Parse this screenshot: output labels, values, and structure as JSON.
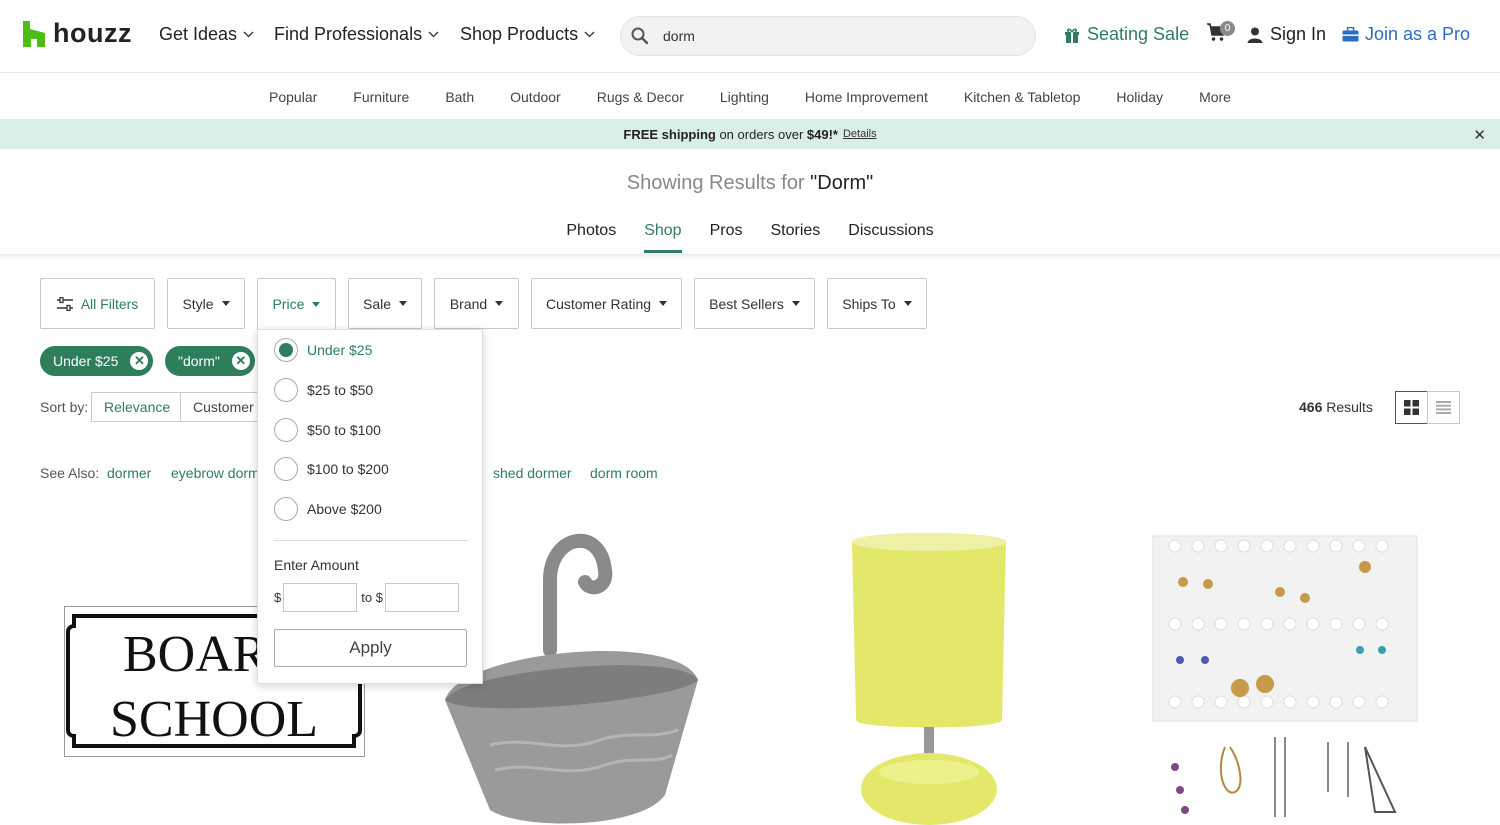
{
  "header": {
    "logo_text": "houzz",
    "nav": [
      {
        "label": "Get Ideas"
      },
      {
        "label": "Find Professionals"
      },
      {
        "label": "Shop Products"
      }
    ],
    "search_value": "dorm",
    "seating_sale": "Seating Sale",
    "cart_count": "0",
    "sign_in": "Sign In",
    "join_pro": "Join as a Pro"
  },
  "subnav": [
    "Popular",
    "Furniture",
    "Bath",
    "Outdoor",
    "Rugs & Decor",
    "Lighting",
    "Home Improvement",
    "Kitchen & Tabletop",
    "Holiday",
    "More"
  ],
  "banner": {
    "free_shipping": "FREE shipping",
    "middle": " on orders over ",
    "amount": "$49!*",
    "details": "Details"
  },
  "results": {
    "prefix": "Showing Results for ",
    "query": "\"Dorm\""
  },
  "tabs": [
    "Photos",
    "Shop",
    "Pros",
    "Stories",
    "Discussions"
  ],
  "filters": {
    "all_filters": "All Filters",
    "style": "Style",
    "price": "Price",
    "sale": "Sale",
    "brand": "Brand",
    "customer_rating": "Customer Rating",
    "best_sellers": "Best Sellers",
    "ships_to": "Ships To"
  },
  "chips": [
    "Under $25",
    "\"dorm\""
  ],
  "sort": {
    "label": "Sort by:",
    "relevance": "Relevance",
    "customer": "Customer"
  },
  "count": {
    "number": "466",
    "label": " Results"
  },
  "see_also": {
    "label": "See Also:",
    "links": [
      "dormer",
      "eyebrow dorm",
      "shed dormer",
      "dorm room"
    ]
  },
  "price_dropdown": {
    "options": [
      "Under $25",
      "$25 to $50",
      "$50 to $100",
      "$100 to $200",
      "Above $200"
    ],
    "selected": "Under $25",
    "enter_amount": "Enter Amount",
    "dollar": "$",
    "to": "to $",
    "apply": "Apply"
  },
  "products": {
    "sign_line1": "BOARD",
    "sign_line2": "SCHOOL"
  },
  "colors": {
    "accent": "#2e7d5b",
    "link_blue": "#2c6ebd",
    "banner_bg": "#d9efe6"
  }
}
